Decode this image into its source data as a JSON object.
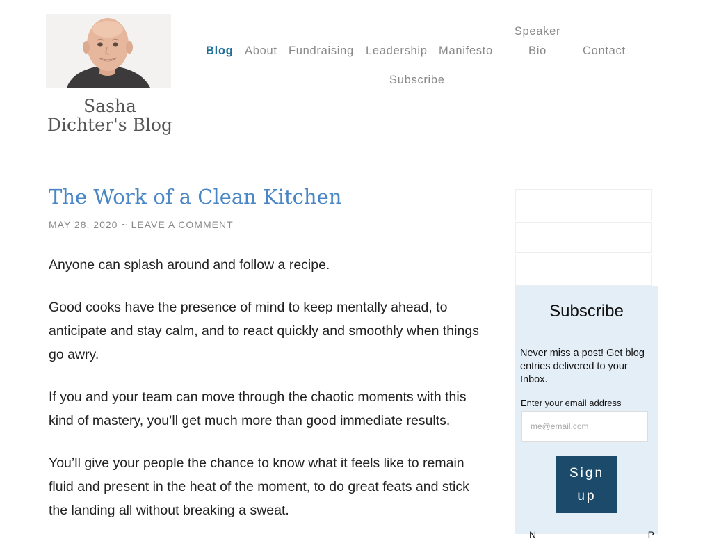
{
  "site": {
    "title": "Sasha Dichter's Blog",
    "avatar_alt": "Portrait of Sasha Dichter"
  },
  "nav": {
    "items": [
      {
        "label": "Blog",
        "active": true
      },
      {
        "label": "About"
      },
      {
        "label": "Fundraising"
      },
      {
        "label": "Leadership"
      },
      {
        "label": "Manifesto"
      },
      {
        "label": "Speaker Bio"
      },
      {
        "label": "Contact"
      },
      {
        "label": "Subscribe"
      }
    ]
  },
  "post": {
    "title": "The Work of a Clean Kitchen",
    "date": "MAY 28, 2020",
    "separator": "~",
    "comment_link": "LEAVE A COMMENT",
    "paragraphs": [
      "Anyone can splash around and follow a recipe.",
      "Good cooks have the presence of mind to keep mentally ahead, to anticipate and stay calm, and to react quickly and smoothly when things go awry.",
      "If you and your team can move through the chaotic moments with this kind of mastery, you’ll get much more than good immediate results.",
      "You’ll give your people the chance to know what it feels like to remain fluid and present in the heat of the moment, to do great feats and stick the landing all without breaking a sweat."
    ]
  },
  "subscribe": {
    "title": "Subscribe",
    "text": "Never miss a post! Get blog entries delivered to your Inbox.",
    "email_label": "Enter your email address",
    "email_placeholder": "me@email.com",
    "button_label": "Sign up",
    "footer_left": "N",
    "footer_right": "P"
  },
  "colors": {
    "accent": "#4a86c5",
    "nav_active": "#1f6f9a",
    "button": "#1b4a6b",
    "widget_bg": "#e4eef7"
  }
}
